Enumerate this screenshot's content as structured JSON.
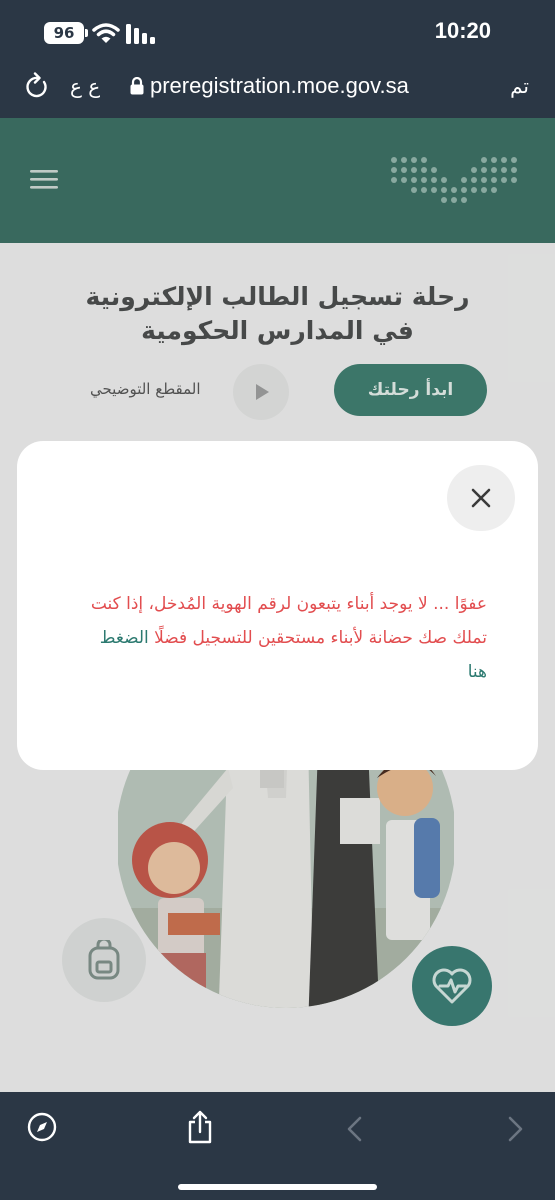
{
  "status_bar": {
    "battery": "96",
    "time": "10:20"
  },
  "browser": {
    "text_size_label": "ع ع",
    "url": "preregistration.moe.gov.sa",
    "done_label": "تم"
  },
  "hero": {
    "title_line1": "رحلة تسجيل الطالب الإلكترونية",
    "title_line2": "في المدارس الحكومية",
    "start_button": "ابدأ رحلتك",
    "video_label": "المقطع التوضيحي"
  },
  "modal": {
    "message": "عفوًا ... لا يوجد أبناء يتبعون لرقم الهوية المُدخل، إذا كنت تملك صك حضانة لأبناء مستحقين للتسجيل فضلًا",
    "link": "الضغط هنا"
  },
  "colors": {
    "header_green": "#3c6e62",
    "error_red": "#e24d4f",
    "link_teal": "#2c7a70",
    "browser_chrome": "#2b3745"
  },
  "icons": [
    "wifi-icon",
    "signal-icon",
    "reload-icon",
    "lock-icon",
    "menu-icon",
    "play-icon",
    "close-icon",
    "backpack-icon",
    "heart-pulse-icon",
    "compass-icon",
    "share-icon",
    "back-arrow-icon",
    "forward-arrow-icon"
  ]
}
